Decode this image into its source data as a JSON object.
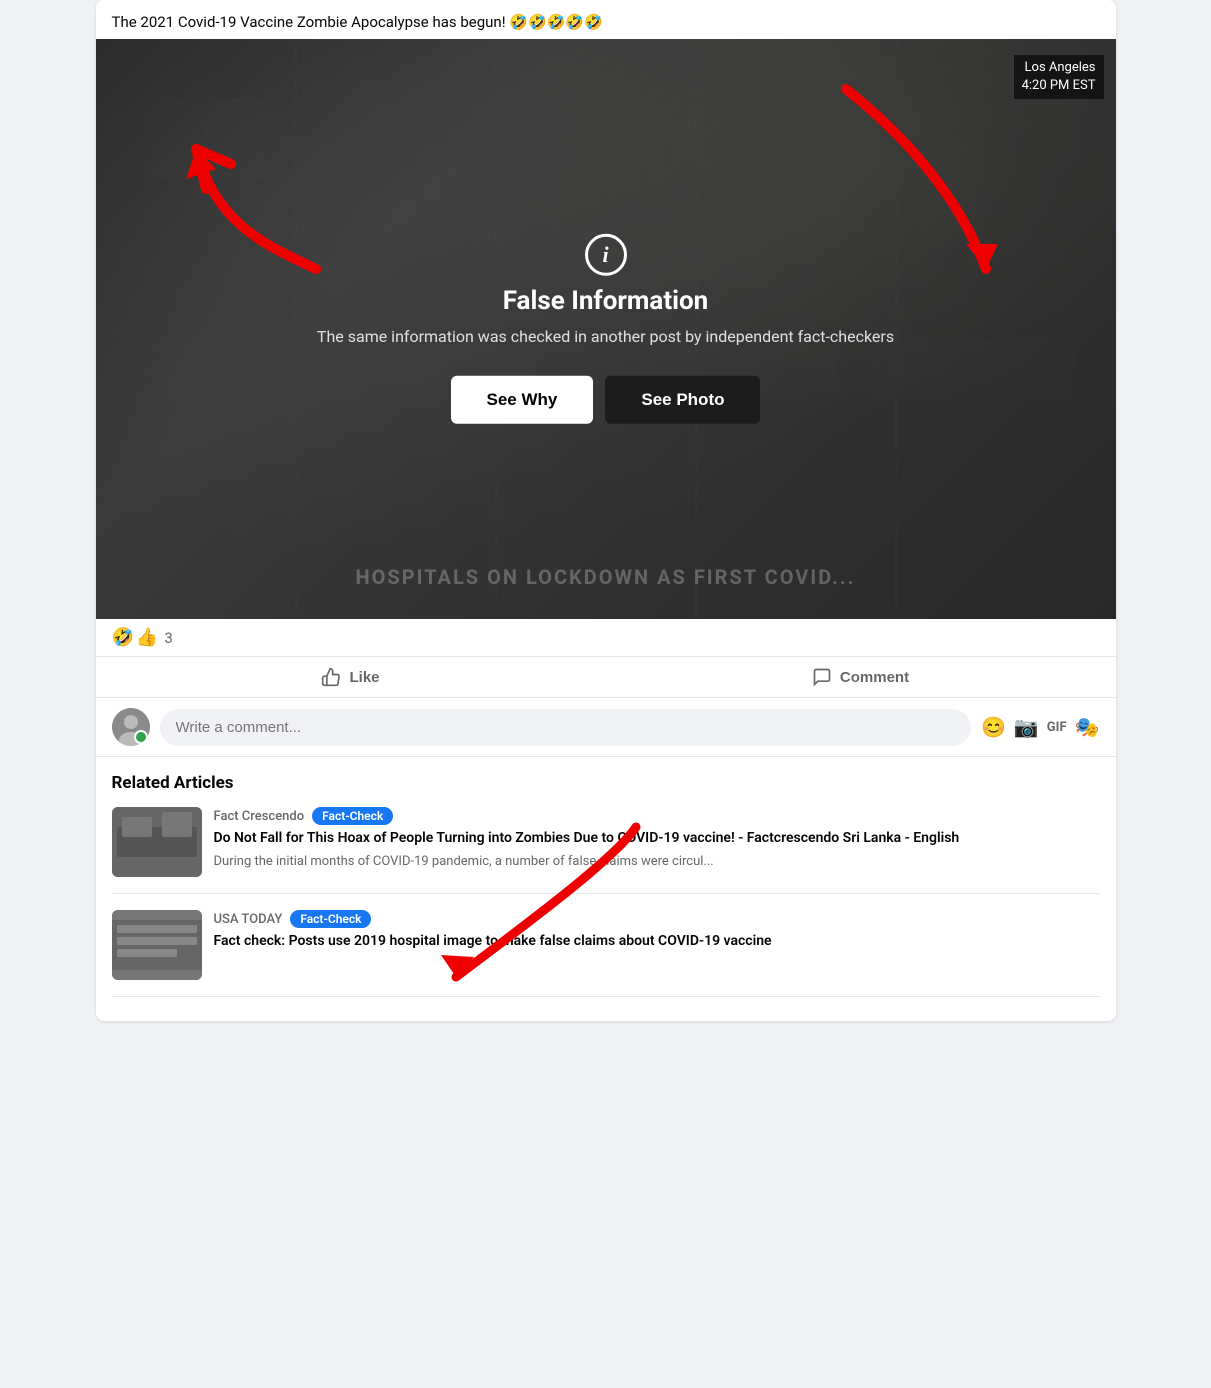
{
  "post": {
    "title": "The 2021 Covid-19 Vaccine Zombie Apocalypse has begun! 🤣🤣🤣🤣🤣",
    "image": {
      "location_city": "Los Angeles",
      "location_time": "4:20 PM EST",
      "watermark": "HOSPITALS ON LOCKDOWN AS FIRST COVID..."
    },
    "false_info": {
      "icon": "i",
      "title": "False Information",
      "subtitle": "The same information was checked in another post by independent fact-checkers",
      "btn_see_why": "See Why",
      "btn_see_photo": "See Photo"
    },
    "reactions": {
      "emoji1": "🤣",
      "emoji2": "👍",
      "count": "3"
    },
    "actions": {
      "like": "Like",
      "comment": "Comment"
    },
    "comment_placeholder": "Write a comment...",
    "input_icons": {
      "emoji": "😊",
      "camera": "📷",
      "gif": "GIF",
      "sticker": "🎭"
    }
  },
  "related_articles": {
    "title": "Related Articles",
    "items": [
      {
        "source": "Fact Crescendo",
        "badge": "Fact-Check",
        "headline": "Do Not Fall for This Hoax of People Turning into Zombies Due to COVID-19 vaccine! - Factcrescendo Sri Lanka - English",
        "desc": "During the initial months of COVID-19 pandemic, a number of false claims were circul..."
      },
      {
        "source": "USA TODAY",
        "badge": "Fact-Check",
        "headline": "Fact check: Posts use 2019 hospital image to make false claims about COVID-19 vaccine",
        "desc": ""
      }
    ]
  }
}
